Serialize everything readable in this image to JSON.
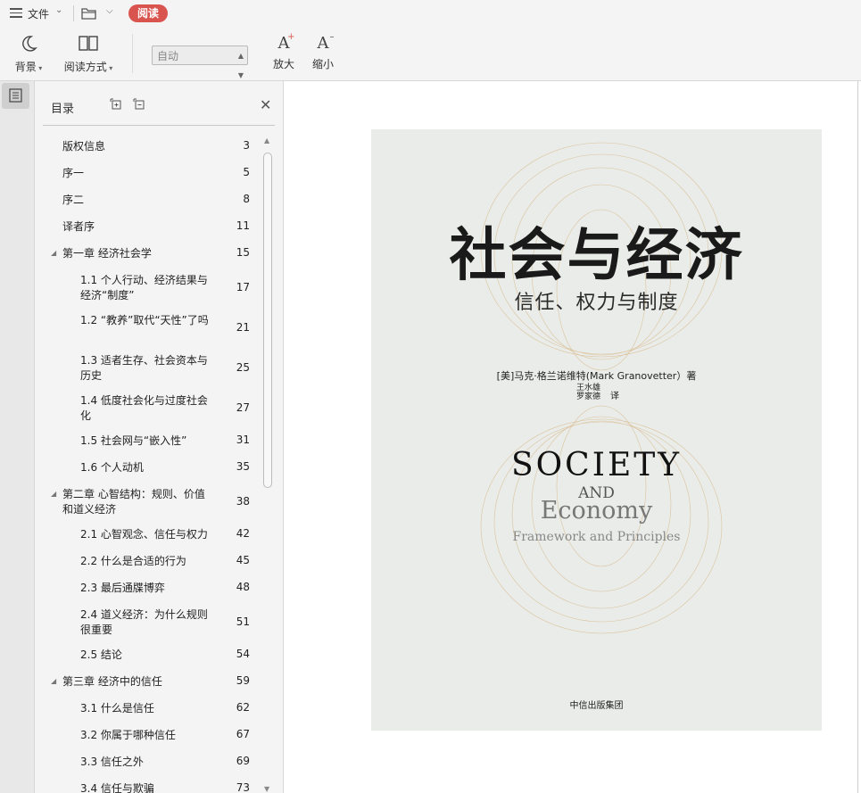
{
  "menu": {
    "file": "文件",
    "read_mode_pill": "阅读"
  },
  "toolbar": {
    "background": "背景",
    "read_mode": "阅读方式",
    "page_mode_select": "自动",
    "zoom_in": "放大",
    "zoom_out": "缩小"
  },
  "toc": {
    "title": "目录",
    "items": [
      {
        "text": "版权信息",
        "page": "3",
        "level": 1,
        "expander": false
      },
      {
        "text": "序一",
        "page": "5",
        "level": 1,
        "expander": false
      },
      {
        "text": "序二",
        "page": "8",
        "level": 1,
        "expander": false
      },
      {
        "text": "译者序",
        "page": "11",
        "level": 1,
        "expander": false
      },
      {
        "text": "第一章 经济社会学",
        "page": "15",
        "level": 1,
        "expander": true
      },
      {
        "text": "1.1 个人行动、经济结果与经济“制度”",
        "page": "17",
        "level": 2,
        "expander": false
      },
      {
        "text": "1.2 “教养”取代“天性”了吗",
        "page": "21",
        "level": 2,
        "expander": false
      },
      {
        "text": "1.3 适者生存、社会资本与历史",
        "page": "25",
        "level": 2,
        "expander": false
      },
      {
        "text": "1.4 低度社会化与过度社会化",
        "page": "27",
        "level": 2,
        "expander": false
      },
      {
        "text": "1.5 社会网与“嵌入性”",
        "page": "31",
        "level": 2,
        "expander": false
      },
      {
        "text": "1.6 个人动机",
        "page": "35",
        "level": 2,
        "expander": false
      },
      {
        "text": "第二章 心智结构：规则、价值和道义经济",
        "page": "38",
        "level": 1,
        "expander": true
      },
      {
        "text": "2.1 心智观念、信任与权力",
        "page": "42",
        "level": 2,
        "expander": false
      },
      {
        "text": "2.2 什么是合适的行为",
        "page": "45",
        "level": 2,
        "expander": false
      },
      {
        "text": "2.3 最后通牒博弈",
        "page": "48",
        "level": 2,
        "expander": false
      },
      {
        "text": "2.4 道义经济：为什么规则很重要",
        "page": "51",
        "level": 2,
        "expander": false
      },
      {
        "text": "2.5 结论",
        "page": "54",
        "level": 2,
        "expander": false
      },
      {
        "text": "第三章 经济中的信任",
        "page": "59",
        "level": 1,
        "expander": true
      },
      {
        "text": "3.1 什么是信任",
        "page": "62",
        "level": 2,
        "expander": false
      },
      {
        "text": "3.2 你属于哪种信任",
        "page": "67",
        "level": 2,
        "expander": false
      },
      {
        "text": "3.3 信任之外",
        "page": "69",
        "level": 2,
        "expander": false
      },
      {
        "text": "3.4 信任与欺骗",
        "page": "73",
        "level": 2,
        "expander": false
      }
    ]
  },
  "cover": {
    "title_cn": "社会与经济",
    "subtitle_cn": "信任、权力与制度",
    "author": "[美]马克·格兰诺维特(Mark Granovetter）著",
    "translator_1": "王水雄",
    "translator_2": "罗家德",
    "translator_role": "译",
    "title_en_1": "SOCIETY",
    "title_en_2": "AND",
    "title_en_3": "Economy",
    "title_en_4": "Framework and Principles",
    "publisher": "中信出版集团"
  },
  "colors": {
    "accent_pill": "#d9534f",
    "cover_bg": "#e9ece9",
    "cover_rings": "#d9b98a"
  }
}
